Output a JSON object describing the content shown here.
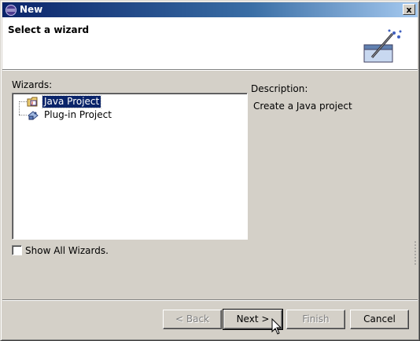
{
  "window": {
    "title": "New",
    "close_label": "x"
  },
  "banner": {
    "title": "Select a wizard",
    "icon": "new-wizard-icon"
  },
  "wizards": {
    "label": "Wizards:",
    "items": [
      {
        "label": "Java Project",
        "icon": "java-project-icon",
        "selected": true
      },
      {
        "label": "Plug-in Project",
        "icon": "plugin-project-icon",
        "selected": false
      }
    ]
  },
  "description": {
    "label": "Description:",
    "text": "Create a Java project"
  },
  "show_all": {
    "label": "Show All Wizards.",
    "checked": false
  },
  "buttons": {
    "back": "< Back",
    "next": "Next >",
    "finish": "Finish",
    "cancel": "Cancel"
  },
  "colors": {
    "titlebar_start": "#0a246a",
    "titlebar_end": "#a6caf0",
    "dialog_bg": "#d4d0c8",
    "selection": "#0a246a"
  }
}
